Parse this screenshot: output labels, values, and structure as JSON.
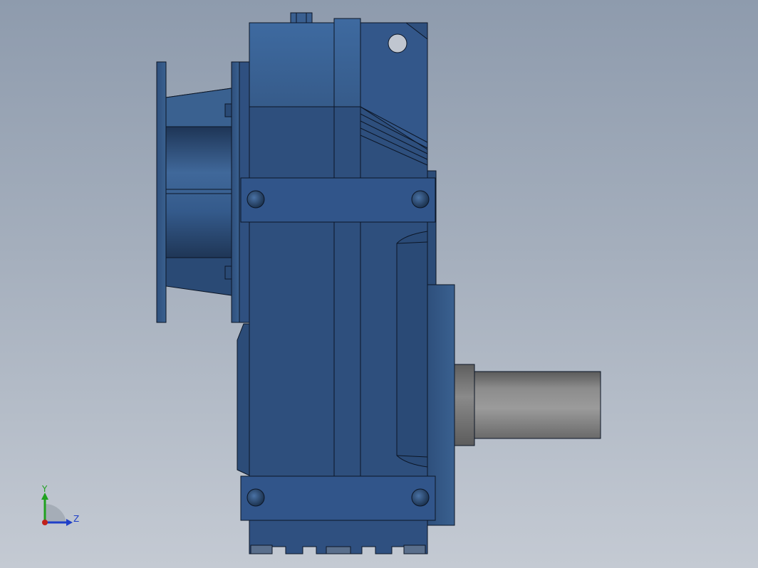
{
  "viewport": {
    "background_top": "#8e9bad",
    "background_bottom": "#c4cad3"
  },
  "model": {
    "body_color": "#35557f",
    "shaft_color": "#8a8a8a",
    "outline_color": "#0c1626"
  },
  "triad": {
    "y_label": "Y",
    "z_label": "Z",
    "y_color": "#1fa11f",
    "z_color": "#1f3fc8",
    "x_color": "#c0201a"
  }
}
